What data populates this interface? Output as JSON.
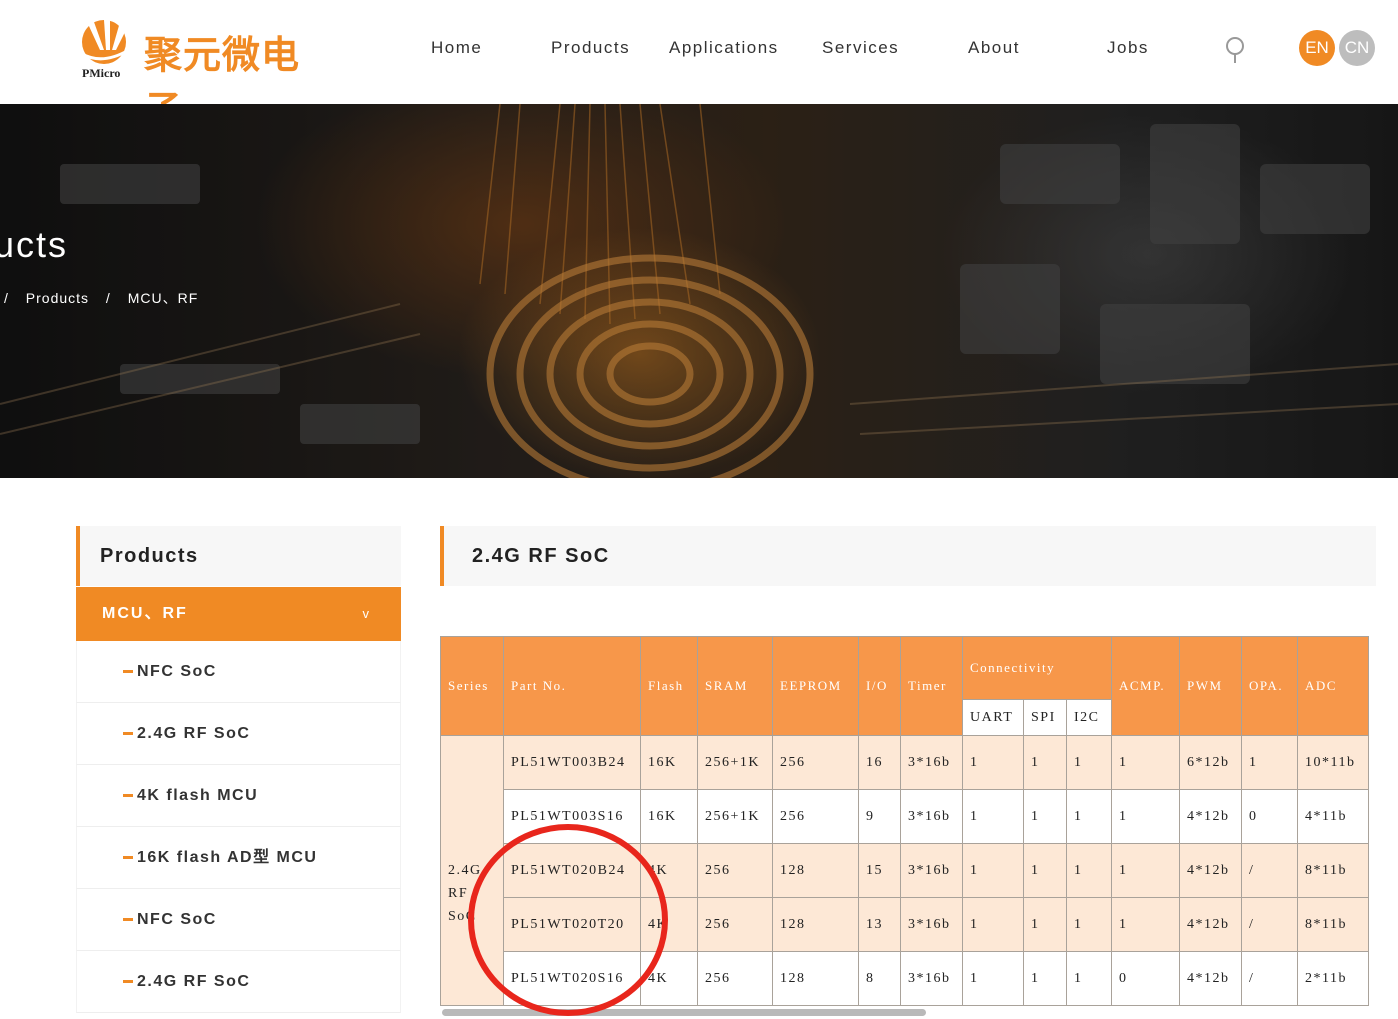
{
  "header": {
    "logo_cn": "聚元微电子",
    "logo_en": "PMicro",
    "nav": [
      "Home",
      "Products",
      "Applications",
      "Services",
      "About",
      "Jobs"
    ],
    "lang_en": "EN",
    "lang_cn": "CN",
    "accent": "#f08a24"
  },
  "banner": {
    "title": "ucts",
    "breadcrumb": [
      "/",
      "Products",
      "/",
      "MCU、RF"
    ]
  },
  "sidebar": {
    "title": "Products",
    "active": "MCU、RF",
    "active_chevron": "v",
    "items": [
      "NFC SoC",
      "2.4G RF SoC",
      "4K flash MCU",
      "16K flash AD型 MCU",
      "NFC SoC",
      "2.4G RF SoC"
    ]
  },
  "content": {
    "title": "2.4G RF SoC"
  },
  "table": {
    "headers": [
      "Series",
      "Part No.",
      "Flash",
      "SRAM",
      "EEPROM",
      "I/O",
      "Timer",
      "Connectivity",
      "ACMP.",
      "PWM",
      "OPA.",
      "ADC"
    ],
    "sub_headers": [
      "UART",
      "SPI",
      "I2C"
    ],
    "series_lines": [
      "2.4G",
      "RF",
      "SoC"
    ],
    "rows": [
      [
        "PL51WT003B24",
        "16K",
        "256+1K",
        "256",
        "16",
        "3*16b",
        "1",
        "1",
        "1",
        "1",
        "6*12b",
        "1",
        "10*11b"
      ],
      [
        "PL51WT003S16",
        "16K",
        "256+1K",
        "256",
        "9",
        "3*16b",
        "1",
        "1",
        "1",
        "1",
        "4*12b",
        "0",
        "4*11b"
      ],
      [
        "PL51WT020B24",
        "4K",
        "256",
        "128",
        "15",
        "3*16b",
        "1",
        "1",
        "1",
        "1",
        "4*12b",
        "/",
        "8*11b"
      ],
      [
        "PL51WT020T20",
        "4K",
        "256",
        "128",
        "13",
        "3*16b",
        "1",
        "1",
        "1",
        "1",
        "4*12b",
        "/",
        "8*11b"
      ],
      [
        "PL51WT020S16",
        "4K",
        "256",
        "128",
        "8",
        "3*16b",
        "1",
        "1",
        "1",
        "0",
        "4*12b",
        "/",
        "2*11b"
      ]
    ],
    "header_bg": "#f7974a",
    "row_alt_bg": "#fde8d6"
  },
  "annotation_color": "#e8261c"
}
